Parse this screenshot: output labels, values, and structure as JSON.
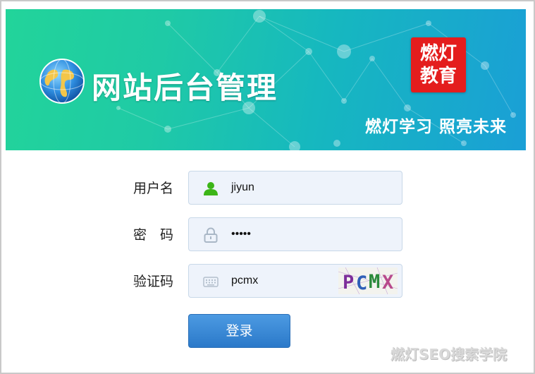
{
  "banner": {
    "site_title": "网站后台管理",
    "brand_line1": "燃灯",
    "brand_line2": "教育",
    "slogan": "燃灯学习 照亮未来"
  },
  "form": {
    "username": {
      "label": "用户名",
      "value": "jiyun",
      "icon": "user-icon"
    },
    "password": {
      "label": "密　码",
      "value": "•••••",
      "icon": "lock-icon"
    },
    "captcha": {
      "label": "验证码",
      "value": "pcmx",
      "image_text": "PCMX",
      "icon": "keyboard-icon"
    },
    "login_label": "登录"
  },
  "watermark": "燃灯SEO搜索学院",
  "colors": {
    "banner_start": "#22d49a",
    "banner_end": "#1a9fd6",
    "button": "#2b79c9",
    "field_bg": "#eef3fb",
    "brand_red": "#e41d1d",
    "user_icon": "#3cb517"
  }
}
